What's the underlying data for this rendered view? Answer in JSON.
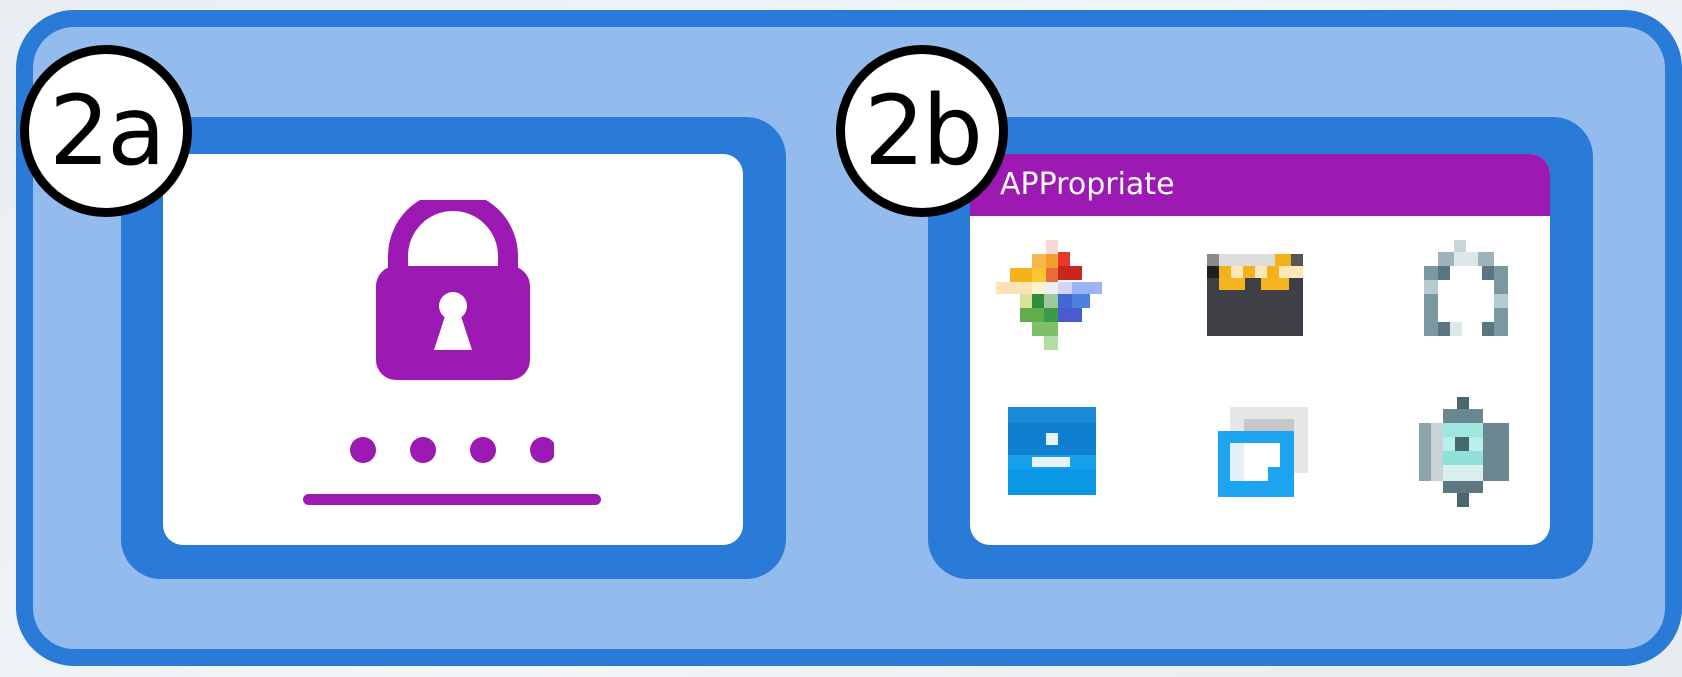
{
  "panel_a": {
    "badge": "2a",
    "lock_icon": "padlock-icon",
    "password_dot_count": 4
  },
  "panel_b": {
    "badge": "2b",
    "window_title": "APPropriate",
    "apps": [
      {
        "icon": "pinwheel-app-icon"
      },
      {
        "icon": "clapperboard-app-icon"
      },
      {
        "icon": "ring-app-icon"
      },
      {
        "icon": "blue-square-app-icon"
      },
      {
        "icon": "blue-window-app-icon"
      },
      {
        "icon": "robot-app-icon"
      }
    ]
  },
  "colors": {
    "accent_purple": "#9c19b3",
    "frame_blue": "#2a7ad8",
    "background_blue": "#93bbee"
  }
}
